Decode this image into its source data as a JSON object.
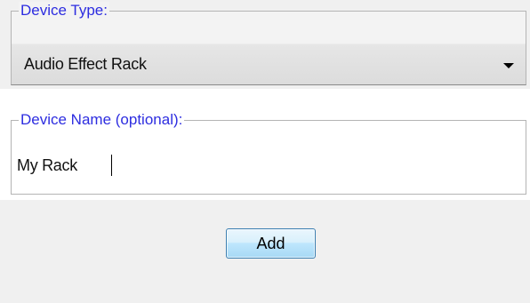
{
  "device_type": {
    "legend": "Device Type:",
    "selected": "Audio Effect Rack",
    "dropdown_icon": "triangle-down-icon"
  },
  "device_name": {
    "legend": "Device Name (optional):",
    "value": "My Rack"
  },
  "actions": {
    "add_label": "Add"
  },
  "colors": {
    "legend_text": "#2d2de0",
    "panel_background": "#f0f0f0",
    "button_border": "#3c7fb1"
  }
}
